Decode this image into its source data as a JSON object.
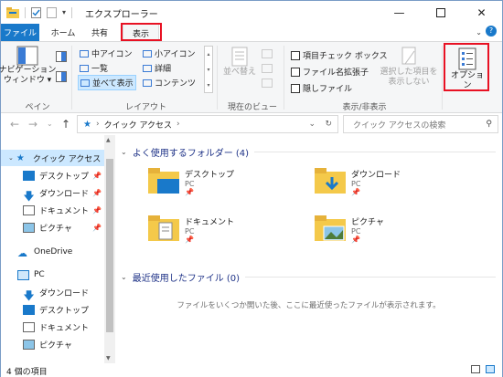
{
  "window": {
    "title": "エクスプローラー",
    "min_icon": "minimize-icon",
    "max_icon": "maximize-icon",
    "close_icon": "close-icon"
  },
  "tabs": [
    {
      "label": "ファイル"
    },
    {
      "label": "ホーム"
    },
    {
      "label": "共有"
    },
    {
      "label": "表示"
    }
  ],
  "ribbon": {
    "pane_group": {
      "nav_pane_label": "ナビゲーション\nウィンドウ ▾",
      "group_label": "ペイン"
    },
    "layout_group": {
      "items": [
        "中アイコン",
        "小アイコン",
        "一覧",
        "詳細",
        "並べて表示",
        "コンテンツ"
      ],
      "group_label": "レイアウト"
    },
    "current_view_group": {
      "sort_label": "並べ替え",
      "group_label": "現在のビュー"
    },
    "show_hide_group": {
      "checkboxes": [
        "項目チェック ボックス",
        "ファイル名拡張子",
        "隠しファイル"
      ],
      "hide_selected_label": "選択した項目を\n表示しない",
      "group_label": "表示/非表示"
    },
    "options_label": "オプション"
  },
  "navbar": {
    "address": "クイック アクセス",
    "search_placeholder": "クイック アクセスの検索"
  },
  "navpane": {
    "items": [
      {
        "label": "クイック アクセス",
        "icon": "star-icon"
      },
      {
        "label": "デスクトップ",
        "icon": "desktop-icon"
      },
      {
        "label": "ダウンロード",
        "icon": "download-icon"
      },
      {
        "label": "ドキュメント",
        "icon": "document-icon"
      },
      {
        "label": "ピクチャ",
        "icon": "picture-icon"
      },
      {
        "label": "OneDrive",
        "icon": "cloud-icon"
      },
      {
        "label": "PC",
        "icon": "pc-icon"
      },
      {
        "label": "ダウンロード",
        "icon": "download-icon"
      },
      {
        "label": "デスクトップ",
        "icon": "desktop-icon"
      },
      {
        "label": "ドキュメント",
        "icon": "document-icon"
      },
      {
        "label": "ピクチャ",
        "icon": "picture-icon"
      }
    ]
  },
  "main": {
    "frequent_header": "よく使用するフォルダー (4)",
    "folders": [
      {
        "name": "デスクトップ",
        "location": "PC"
      },
      {
        "name": "ダウンロード",
        "location": "PC"
      },
      {
        "name": "ドキュメント",
        "location": "PC"
      },
      {
        "name": "ピクチャ",
        "location": "PC"
      }
    ],
    "recent_header": "最近使用したファイル (0)",
    "empty_message": "ファイルをいくつか開いた後、ここに最近使ったファイルが表示されます。"
  },
  "status": {
    "item_count": "4 個の項目"
  },
  "colors": {
    "accent": "#1979ca",
    "highlight": "#e81123",
    "folder": "#f4c94a"
  }
}
